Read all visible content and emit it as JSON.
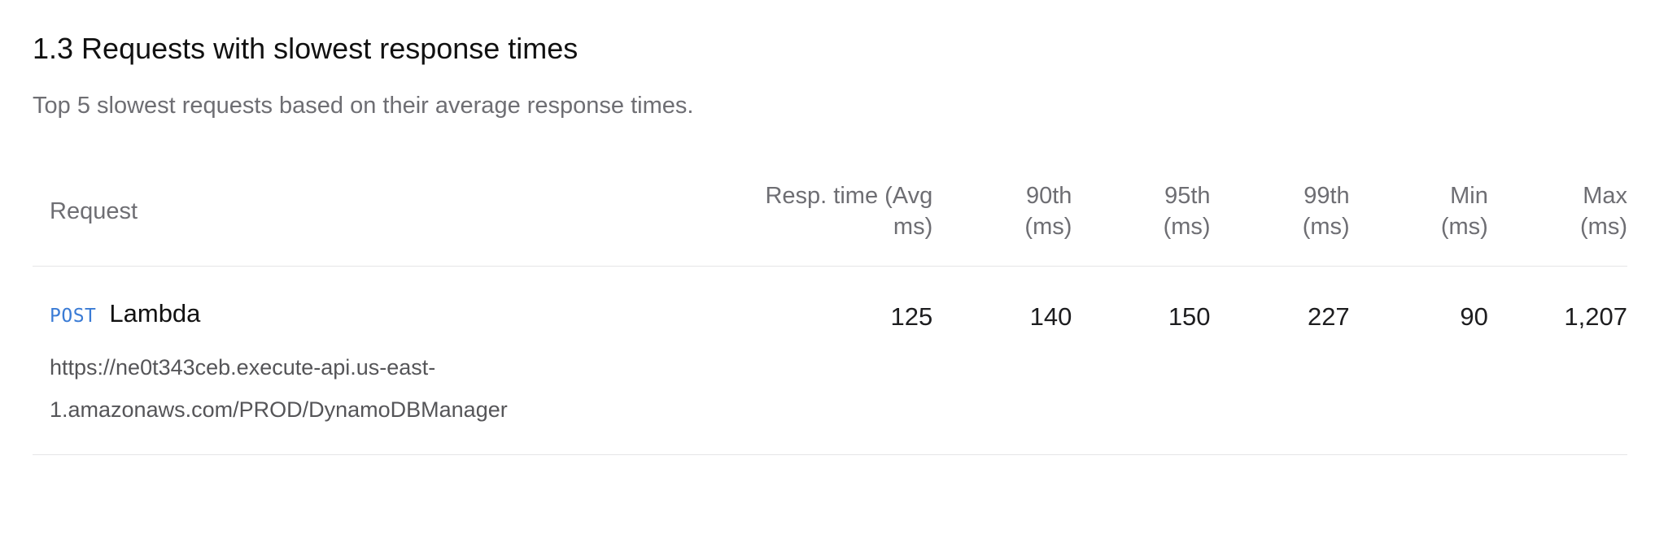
{
  "section": {
    "title": "1.3 Requests with slowest response times",
    "description": "Top 5 slowest requests based on their average response times."
  },
  "table": {
    "headers": {
      "request": "Request",
      "avg_line1": "Resp. time (Avg",
      "avg_line2": "ms)",
      "p90_line1": "90th",
      "p90_line2": "(ms)",
      "p95_line1": "95th",
      "p95_line2": "(ms)",
      "p99_line1": "99th",
      "p99_line2": "(ms)",
      "min_line1": "Min",
      "min_line2": "(ms)",
      "max_line1": "Max",
      "max_line2": "(ms)"
    },
    "rows": [
      {
        "method": "POST",
        "name": "Lambda",
        "url_line1": "https://ne0t343ceb.execute-api.us-east-",
        "url_line2": "1.amazonaws.com/PROD/DynamoDBManager",
        "avg": "125",
        "p90": "140",
        "p95": "150",
        "p99": "227",
        "min": "90",
        "max": "1,207"
      }
    ]
  },
  "colors": {
    "method_badge": "#3a7bd5",
    "muted_text": "#6e6e73",
    "divider": "#e5e5e7"
  }
}
